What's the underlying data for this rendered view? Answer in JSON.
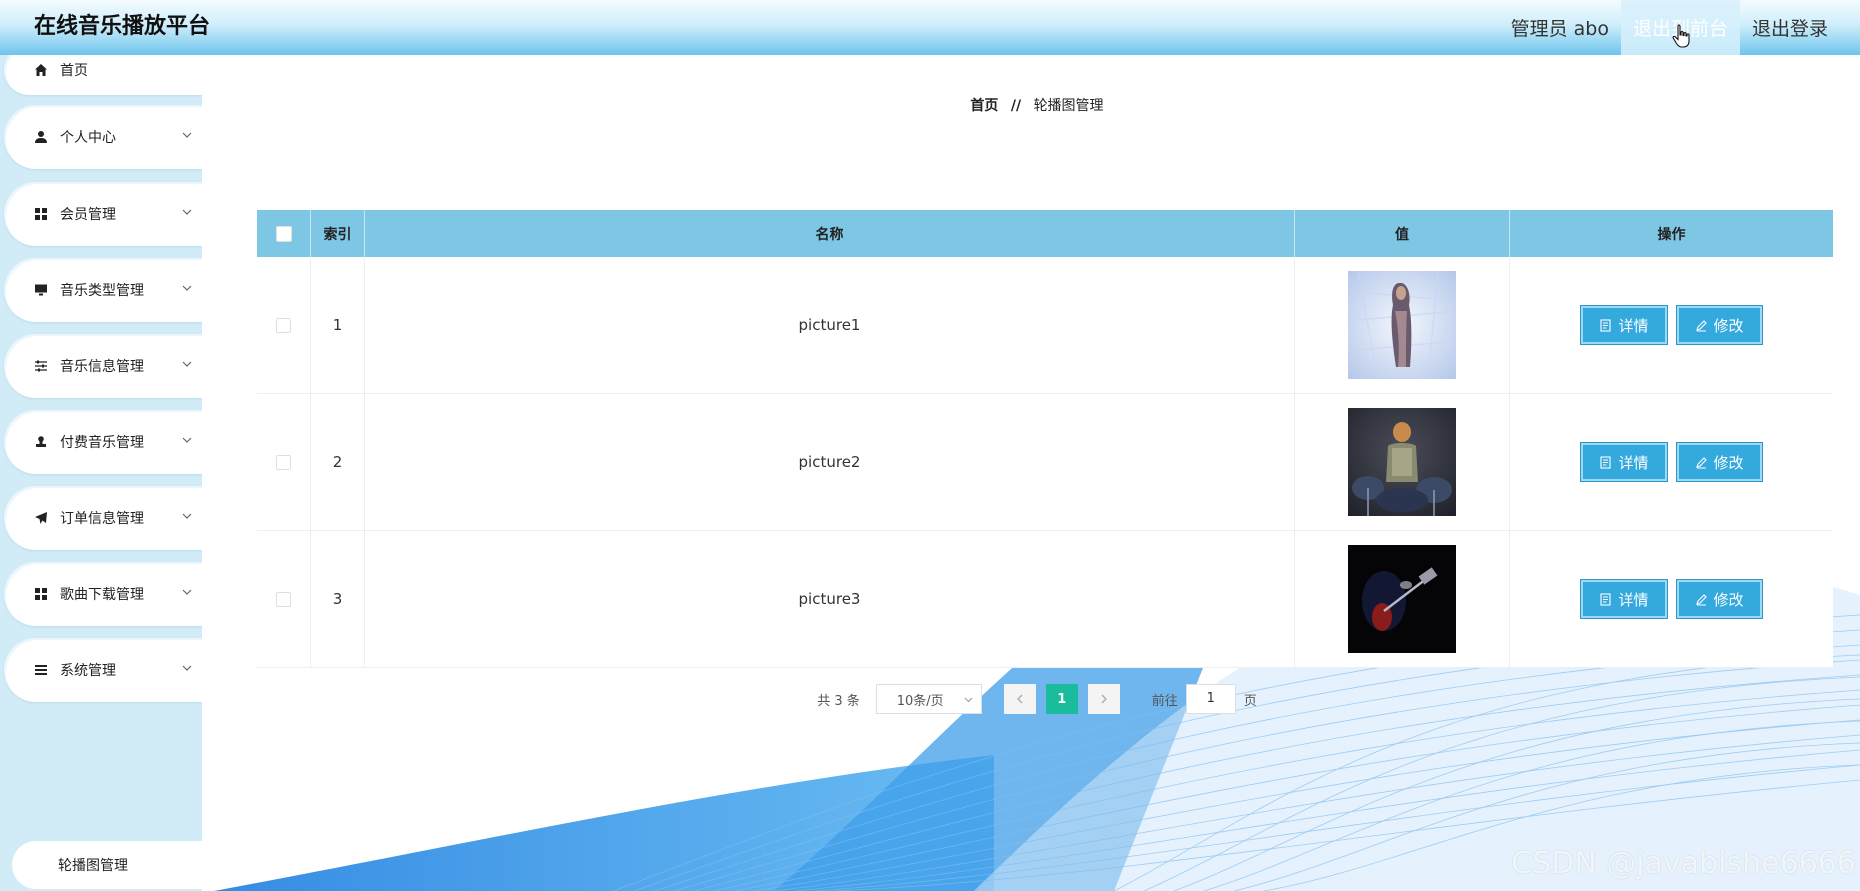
{
  "header": {
    "title": "在线音乐播放平台",
    "user": "管理员 abo",
    "front_link": "退出到前台",
    "logout": "退出登录"
  },
  "sidebar": {
    "items": [
      {
        "label": "首页",
        "icon": "home-icon"
      },
      {
        "label": "个人中心",
        "icon": "user-icon"
      },
      {
        "label": "会员管理",
        "icon": "grid-icon"
      },
      {
        "label": "音乐类型管理",
        "icon": "monitor-icon"
      },
      {
        "label": "音乐信息管理",
        "icon": "sliders-icon"
      },
      {
        "label": "付费音乐管理",
        "icon": "stamp-icon"
      },
      {
        "label": "订单信息管理",
        "icon": "send-icon"
      },
      {
        "label": "歌曲下载管理",
        "icon": "grid-icon"
      },
      {
        "label": "系统管理",
        "icon": "list-icon"
      }
    ],
    "sub_item": "轮播图管理"
  },
  "breadcrumb": {
    "home": "首页",
    "sep": "//",
    "current": "轮播图管理"
  },
  "table": {
    "columns": [
      "索引",
      "名称",
      "值",
      "操作"
    ],
    "rows": [
      {
        "index": "1",
        "name": "picture1",
        "image": "woman-portrait-image"
      },
      {
        "index": "2",
        "name": "picture2",
        "image": "drummer-image"
      },
      {
        "index": "3",
        "name": "picture3",
        "image": "guitar-dark-image"
      }
    ],
    "detail_label": "详情",
    "edit_label": "修改"
  },
  "pagination": {
    "total": "共 3 条",
    "page_size": "10条/页",
    "current_page": "1",
    "goto_label": "前往",
    "goto_value": "1",
    "page_unit": "页"
  },
  "watermark": "CSDN @javabishe6666",
  "colors": {
    "header_accent": "#6ec4ec",
    "sidebar_bg": "#d2ecf7",
    "table_head": "#7dc6e4",
    "button": "#34a9de",
    "page_active": "#1abc9c"
  }
}
